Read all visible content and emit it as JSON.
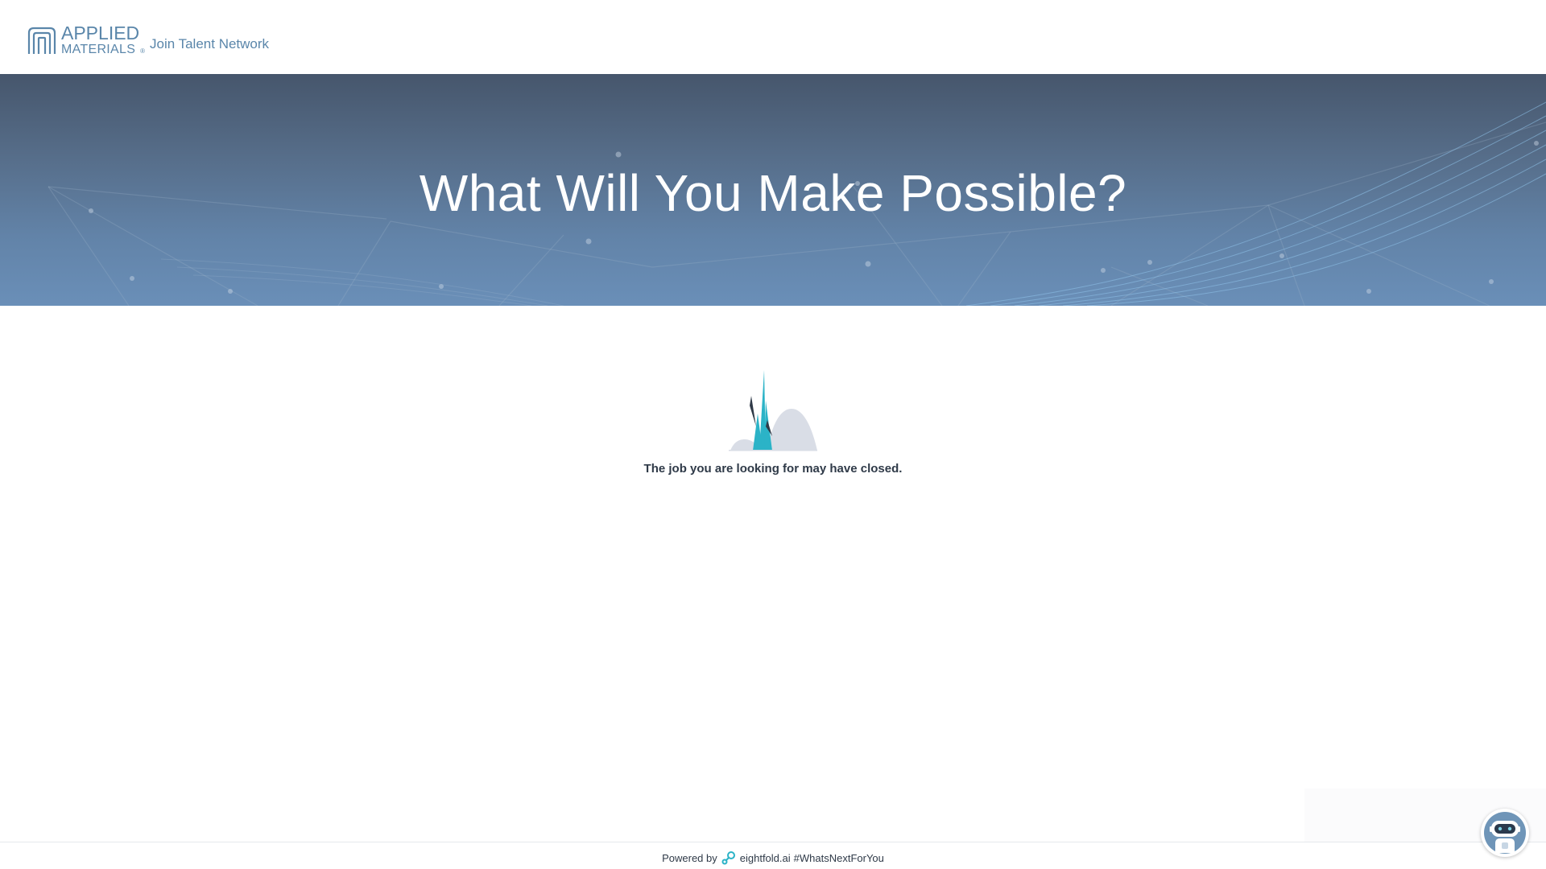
{
  "header": {
    "logo": {
      "line1": "APPLIED",
      "line2": "MATERIALS",
      "reg": "®",
      "color": "#5a86aa"
    },
    "talent_link": "Join Talent Network"
  },
  "hero": {
    "title": "What Will You Make Possible?"
  },
  "empty_state": {
    "message": "The job you are looking for may have closed.",
    "icon": "closed-job-illustration"
  },
  "footer": {
    "powered_by": "Powered by",
    "brand": "eightfold.ai",
    "hashtag": "#WhatsNextForYou",
    "icon": "eightfold-logo-icon"
  },
  "chat": {
    "icon": "chatbot-robot-icon"
  },
  "colors": {
    "accent": "#5a86aa",
    "illustration_teal": "#2bb3c7",
    "text_dark": "#2f3a48"
  }
}
